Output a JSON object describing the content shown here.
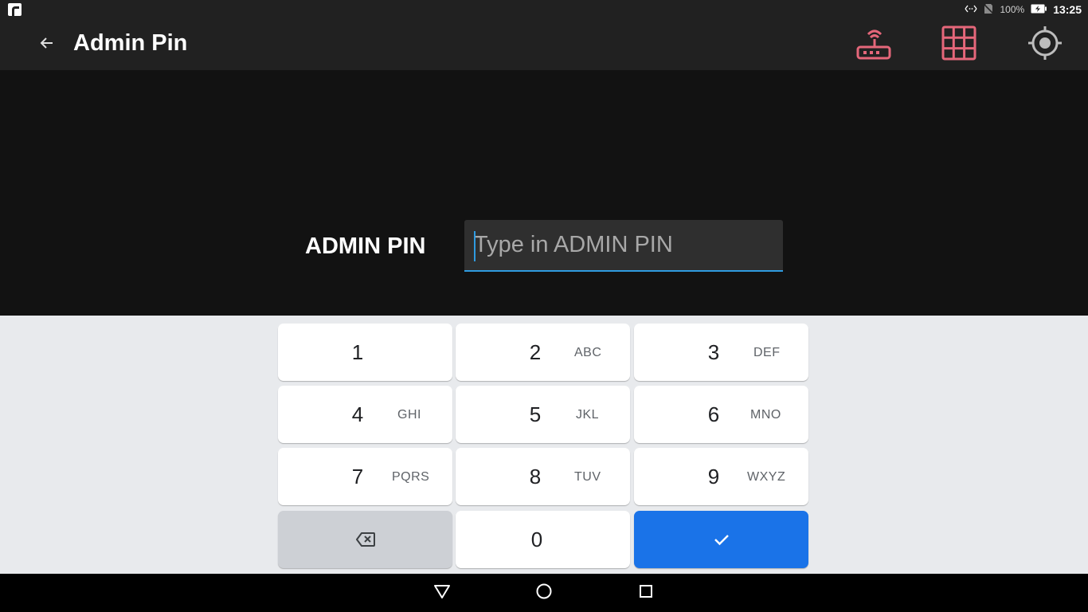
{
  "status_bar": {
    "battery": "100%",
    "time": "13:25",
    "icons": [
      "app-badge-icon",
      "data-transfer-icon",
      "no-sim-icon",
      "battery-charging-icon"
    ]
  },
  "app_bar": {
    "title": "Admin Pin",
    "icons": [
      "back-arrow-icon",
      "router-icon",
      "grid-icon",
      "gps-locate-icon"
    ],
    "accent_color": "#e5677a"
  },
  "form": {
    "label": "ADMIN PIN",
    "pin_value": "",
    "pin_placeholder": "Type in ADMIN PIN"
  },
  "keypad": {
    "keys": [
      {
        "digit": "1",
        "letters": ""
      },
      {
        "digit": "2",
        "letters": "ABC"
      },
      {
        "digit": "3",
        "letters": "DEF"
      },
      {
        "digit": "4",
        "letters": "GHI"
      },
      {
        "digit": "5",
        "letters": "JKL"
      },
      {
        "digit": "6",
        "letters": "MNO"
      },
      {
        "digit": "7",
        "letters": "PQRS"
      },
      {
        "digit": "8",
        "letters": "TUV"
      },
      {
        "digit": "9",
        "letters": "WXYZ"
      },
      {
        "digit": "0",
        "letters": ""
      }
    ],
    "backspace_icon": "backspace-icon",
    "done_icon": "check-icon",
    "done_color": "#1a73e8"
  },
  "nav_bar": {
    "icons": [
      "back-triangle-icon",
      "home-circle-icon",
      "recents-square-icon"
    ]
  }
}
